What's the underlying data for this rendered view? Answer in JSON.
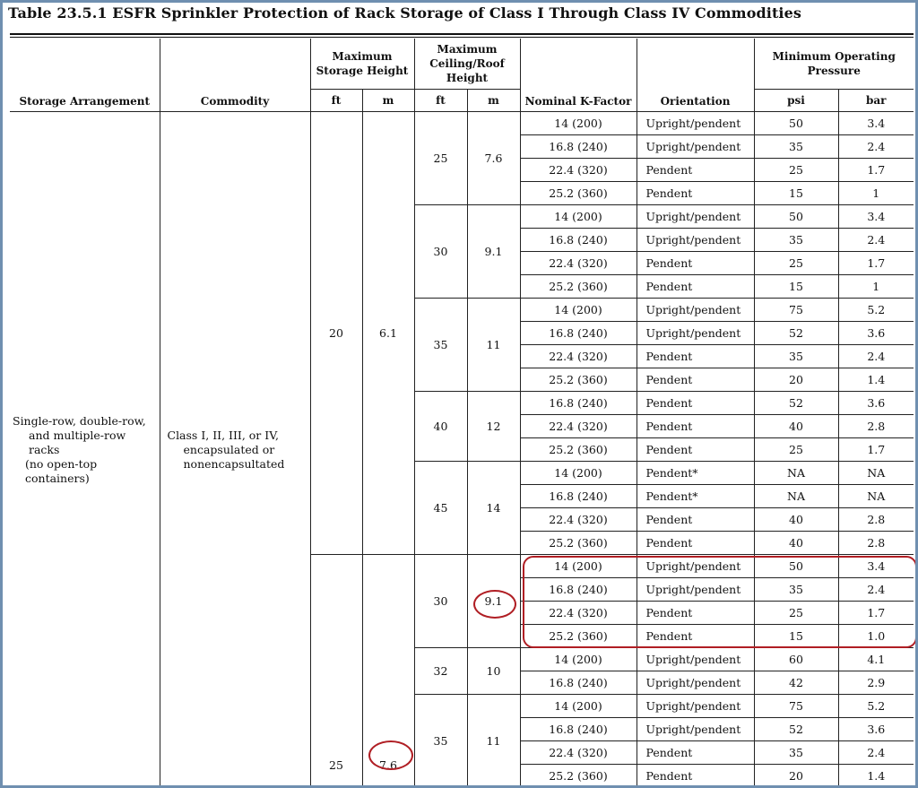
{
  "title": "Table 23.5.1  ESFR Sprinkler Protection of Rack Storage of Class I Through Class IV Commodities",
  "headers": {
    "storage_arrangement": "Storage Arrangement",
    "commodity": "Commodity",
    "max_storage_height": "Maximum Storage Height",
    "max_ceiling_roof_height": "Maximum Ceiling/Roof Height",
    "nominal_k_factor": "Nominal K-Factor",
    "orientation": "Orientation",
    "min_operating_pressure": "Minimum Operating Pressure",
    "ft": "ft",
    "m": "m",
    "psi": "psi",
    "bar": "bar"
  },
  "storage_arrangement_lines": [
    "Single-row, double-row,",
    "and multiple-row racks",
    "(no open-top",
    "containers)"
  ],
  "commodity_lines": [
    "Class I, II, III, or IV,",
    "encapsulated or",
    "nonencapsultated"
  ],
  "storage_groups": [
    {
      "ft": "20",
      "m": "6.1",
      "ceiling_groups": [
        {
          "ft": "25",
          "m": "7.6",
          "rows": [
            {
              "k": "14 (200)",
              "orientation": "Upright/pendent",
              "psi": "50",
              "bar": "3.4"
            },
            {
              "k": "16.8 (240)",
              "orientation": "Upright/pendent",
              "psi": "35",
              "bar": "2.4"
            },
            {
              "k": "22.4 (320)",
              "orientation": "Pendent",
              "psi": "25",
              "bar": "1.7"
            },
            {
              "k": "25.2 (360)",
              "orientation": "Pendent",
              "psi": "15",
              "bar": "1"
            }
          ]
        },
        {
          "ft": "30",
          "m": "9.1",
          "rows": [
            {
              "k": "14 (200)",
              "orientation": "Upright/pendent",
              "psi": "50",
              "bar": "3.4"
            },
            {
              "k": "16.8 (240)",
              "orientation": "Upright/pendent",
              "psi": "35",
              "bar": "2.4"
            },
            {
              "k": "22.4 (320)",
              "orientation": "Pendent",
              "psi": "25",
              "bar": "1.7"
            },
            {
              "k": "25.2 (360)",
              "orientation": "Pendent",
              "psi": "15",
              "bar": "1"
            }
          ]
        },
        {
          "ft": "35",
          "m": "11",
          "rows": [
            {
              "k": "14 (200)",
              "orientation": "Upright/pendent",
              "psi": "75",
              "bar": "5.2"
            },
            {
              "k": "16.8 (240)",
              "orientation": "Upright/pendent",
              "psi": "52",
              "bar": "3.6"
            },
            {
              "k": "22.4 (320)",
              "orientation": "Pendent",
              "psi": "35",
              "bar": "2.4"
            },
            {
              "k": "25.2 (360)",
              "orientation": "Pendent",
              "psi": "20",
              "bar": "1.4"
            }
          ]
        },
        {
          "ft": "40",
          "m": "12",
          "rows": [
            {
              "k": "16.8 (240)",
              "orientation": "Pendent",
              "psi": "52",
              "bar": "3.6"
            },
            {
              "k": "22.4 (320)",
              "orientation": "Pendent",
              "psi": "40",
              "bar": "2.8"
            },
            {
              "k": "25.2 (360)",
              "orientation": "Pendent",
              "psi": "25",
              "bar": "1.7"
            }
          ]
        },
        {
          "ft": "45",
          "m": "14",
          "rows": [
            {
              "k": "14 (200)",
              "orientation": "Pendent*",
              "psi": "NA",
              "bar": "NA"
            },
            {
              "k": "16.8 (240)",
              "orientation": "Pendent*",
              "psi": "NA",
              "bar": "NA"
            },
            {
              "k": "22.4 (320)",
              "orientation": "Pendent",
              "psi": "40",
              "bar": "2.8"
            },
            {
              "k": "25.2 (360)",
              "orientation": "Pendent",
              "psi": "40",
              "bar": "2.8"
            }
          ]
        }
      ]
    },
    {
      "ft": "25",
      "m": "7.6",
      "ceiling_groups": [
        {
          "ft": "30",
          "m": "9.1",
          "rows": [
            {
              "k": "14 (200)",
              "orientation": "Upright/pendent",
              "psi": "50",
              "bar": "3.4"
            },
            {
              "k": "16.8 (240)",
              "orientation": "Upright/pendent",
              "psi": "35",
              "bar": "2.4"
            },
            {
              "k": "22.4 (320)",
              "orientation": "Pendent",
              "psi": "25",
              "bar": "1.7"
            },
            {
              "k": "25.2 (360)",
              "orientation": "Pendent",
              "psi": "15",
              "bar": "1.0"
            }
          ]
        },
        {
          "ft": "32",
          "m": "10",
          "rows": [
            {
              "k": "14 (200)",
              "orientation": "Upright/pendent",
              "psi": "60",
              "bar": "4.1"
            },
            {
              "k": "16.8 (240)",
              "orientation": "Upright/pendent",
              "psi": "42",
              "bar": "2.9"
            }
          ]
        },
        {
          "ft": "35",
          "m": "11",
          "rows": [
            {
              "k": "14 (200)",
              "orientation": "Upright/pendent",
              "psi": "75",
              "bar": "5.2"
            },
            {
              "k": "16.8 (240)",
              "orientation": "Upright/pendent",
              "psi": "52",
              "bar": "3.6"
            },
            {
              "k": "22.4 (320)",
              "orientation": "Pendent",
              "psi": "35",
              "bar": "2.4"
            },
            {
              "k": "25.2 (360)",
              "orientation": "Pendent",
              "psi": "20",
              "bar": "1.4"
            }
          ]
        }
      ]
    }
  ],
  "annotations": {
    "highlight_color": "#b01e24",
    "highlighted_rows": "25 ft storage / 30 ft ceiling group",
    "circled_values": [
      "9.1",
      "7.6"
    ]
  }
}
